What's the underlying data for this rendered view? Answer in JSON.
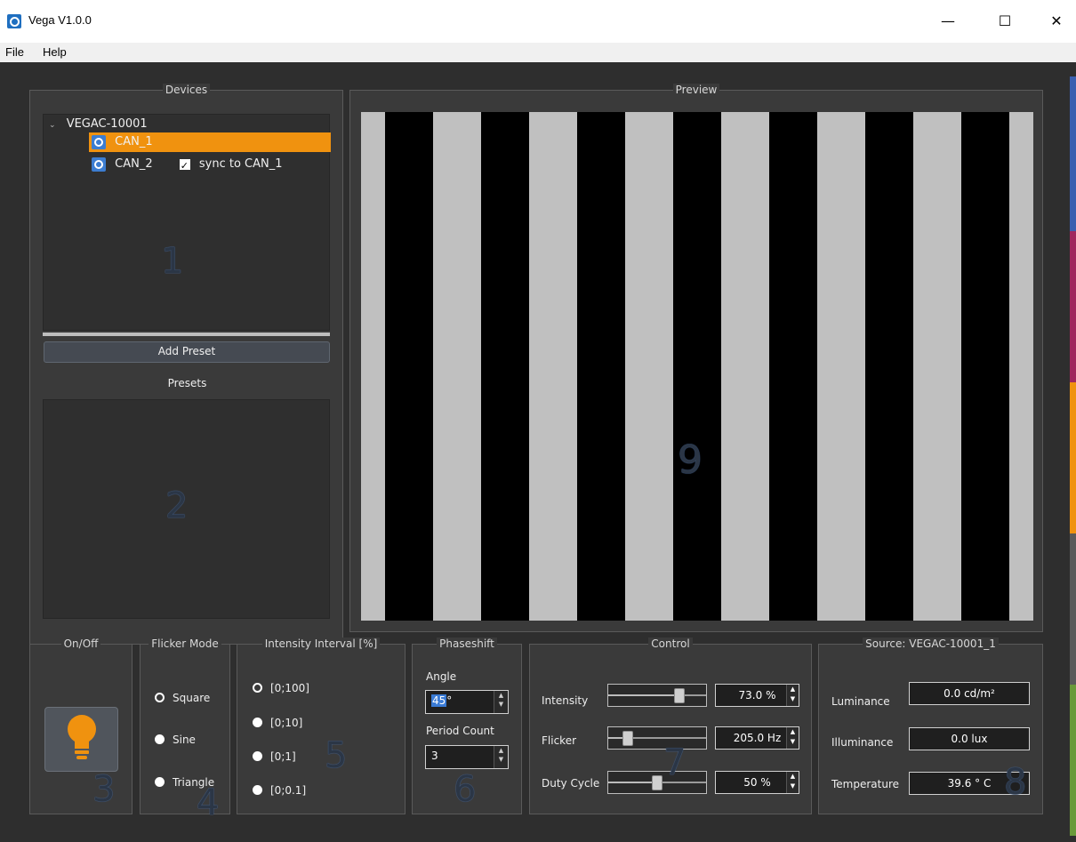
{
  "window": {
    "title": "Vega V1.0.0",
    "minimize": "—",
    "maximize": "☐",
    "close": "✕"
  },
  "menu": {
    "file": "File",
    "help": "Help"
  },
  "devices": {
    "title": "Devices",
    "root": "VEGAC-10001",
    "items": [
      {
        "label": "CAN_1",
        "selected": true
      },
      {
        "label": "CAN_2",
        "sync_label": "sync to CAN_1",
        "sync_checked": true
      }
    ],
    "marker": "1"
  },
  "presets": {
    "add_button": "Add Preset",
    "title": "Presets",
    "marker": "2"
  },
  "preview": {
    "title": "Preview",
    "marker": "9",
    "stripes_light": "#c0c0c0",
    "stripes_dark": "#000000"
  },
  "onoff": {
    "title": "On/Off",
    "marker": "3",
    "bulb_color": "#f0920f"
  },
  "flicker_mode": {
    "title": "Flicker Mode",
    "options": [
      "Square",
      "Sine",
      "Triangle"
    ],
    "selected": "Square",
    "marker": "4"
  },
  "intensity_interval": {
    "title": "Intensity Interval [%]",
    "options": [
      "[0;100]",
      "[0;10]",
      "[0;1]",
      "[0;0.1]"
    ],
    "selected": "[0;100]",
    "marker": "5"
  },
  "phaseshift": {
    "title": "Phaseshift",
    "angle_label": "Angle",
    "angle_value": "45",
    "angle_unit": "°",
    "period_label": "Period Count",
    "period_value": "3",
    "marker": "6"
  },
  "control": {
    "title": "Control",
    "rows": [
      {
        "label": "Intensity",
        "value": "73.0 %",
        "level": 0.73
      },
      {
        "label": "Flicker",
        "value": "205.0 Hz",
        "level": 0.2
      },
      {
        "label": "Duty Cycle",
        "value": "50 %",
        "level": 0.5
      }
    ],
    "marker": "7"
  },
  "source": {
    "title": "Source: VEGAC-10001_1",
    "rows": [
      {
        "label": "Luminance",
        "value": "0.0 cd/m²"
      },
      {
        "label": "Illuminance",
        "value": "0.0 lux"
      },
      {
        "label": "Temperature",
        "value": "39.6 ° C"
      }
    ],
    "marker": "8"
  },
  "accent_colors": {
    "blue": "#3a5fb0",
    "magenta": "#a0275e",
    "orange": "#f0920f",
    "gray": "#5a5a5a",
    "green": "#6a9a3a",
    "selection": "#f0920f"
  }
}
